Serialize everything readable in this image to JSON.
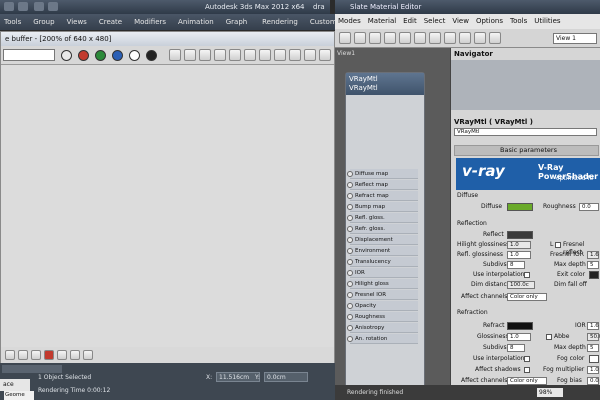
{
  "max": {
    "title": "Autodesk 3ds Max 2012 x64",
    "title_suffix": "dra",
    "menu": [
      "Tools",
      "Group",
      "Views",
      "Create",
      "Modifiers",
      "Animation",
      "Graph Editors",
      "Rendering",
      "Customize"
    ]
  },
  "render_window": {
    "title": "e buffer - [200% of 640 x 480]",
    "status": "1 Object Selected",
    "render_time": "Rendering Time 0:00:12",
    "coord_x_label": "X:",
    "coord_x": "11.516cm",
    "coord_y_label": "Y:",
    "coord_y": "0.0cm",
    "tab_label": "ace",
    "tab2_label": "Geome"
  },
  "slate": {
    "title": "Slate Material Editor",
    "menu": [
      "Modes",
      "Material",
      "Edit",
      "Select",
      "View",
      "Options",
      "Tools",
      "Utilities"
    ],
    "view_tab": "View 1",
    "view_left_label": "View1",
    "navigator": "Navigator",
    "node_title_1": "VRayMtl",
    "node_title_2": "VRayMtl",
    "slots": [
      "Diffuse map",
      "Reflect map",
      "Refract map",
      "Bump map",
      "Refl. gloss.",
      "Refr. gloss.",
      "Displacement",
      "Environment",
      "Translucency",
      "IOR",
      "Hilight gloss",
      "Fresnel IOR",
      "Opacity",
      "Roughness",
      "Anisotropy",
      "An. rotation"
    ],
    "status": "Rendering finished",
    "zoom": "98%"
  },
  "params": {
    "title": "VRayMtl  ( VRayMtl )",
    "name_field": "VRayMtl",
    "rollout": "Basic parameters",
    "banner": "V-Ray PowerShader",
    "banner_logo": "v-ray",
    "banner_sub": "optimized fo",
    "diffuse_group": "Diffuse",
    "diffuse": "Diffuse",
    "roughness": "Roughness",
    "roughness_val": "0.0",
    "reflection_group": "Reflection",
    "reflect": "Reflect",
    "hilight_gloss": "Hilight glossiness",
    "hilight_val": "1.0",
    "l_label": "L",
    "fresnel": "Fresnel reflect",
    "refl_gloss": "Refl. glossiness",
    "refl_gloss_val": "1.0",
    "fresnel_ior": "Fresnel IOR",
    "fresnel_ior_val": "1.6",
    "subdivs": "Subdivs",
    "subdivs_val": "8",
    "max_depth": "Max depth",
    "max_depth_val": "5",
    "use_interp": "Use interpolation",
    "exit_color": "Exit color",
    "dim_distance": "Dim distance",
    "dim_val": "100.0c",
    "dim_falloff": "Dim fall off",
    "affect_channels": "Affect channels",
    "color_only": "Color only",
    "refraction_group": "Refraction",
    "refract": "Refract",
    "ior": "IOR",
    "ior_val": "1.6",
    "glossiness": "Glossiness",
    "gloss_val": "1.0",
    "abbe": "Abbe",
    "abbe_val": "50.0",
    "subdivs2_val": "8",
    "max_depth2_val": "5",
    "fog_color": "Fog color",
    "affect_shadows": "Affect shadows",
    "fog_mult": "Fog multiplier",
    "fog_mult_val": "1.0",
    "affect_channels2": "Affect channels",
    "fog_bias": "Fog bias",
    "fog_bias_val": "0.0"
  },
  "colors": {
    "diffuse": "#6aaa2a",
    "banner": "#1f5fa8",
    "accent": "#3f536b"
  }
}
